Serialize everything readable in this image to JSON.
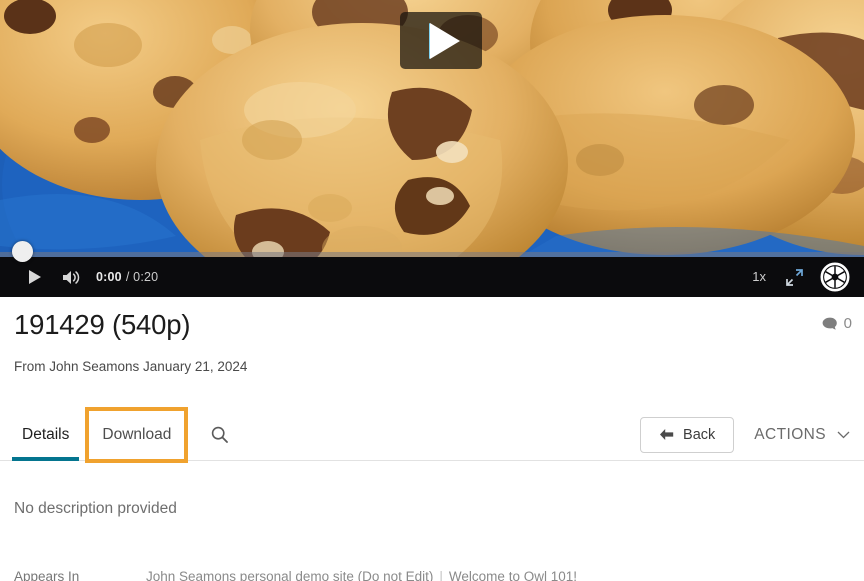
{
  "player": {
    "poster_alt": "chocolate-chip-cookies-on-blue-plate",
    "play_overlay_label": "Play",
    "controls": {
      "play_label": "Play",
      "volume_label": "Mute",
      "current_time": "0:00",
      "duration": "/ 0:20",
      "speed": "1x",
      "fullscreen_label": "Fullscreen",
      "settings_label": "Settings"
    }
  },
  "header": {
    "title": "191429 (540p)",
    "byline": "From John Seamons January 21, 2024",
    "comment_count": "0"
  },
  "tabs": [
    {
      "label": "Details",
      "active": true
    },
    {
      "label": "Download",
      "active": false,
      "highlighted": true
    }
  ],
  "toolbar": {
    "search_label": "Search",
    "back_label": "Back",
    "actions_label": "ACTIONS"
  },
  "body": {
    "description": "No description provided",
    "appears_in_label": "Appears In",
    "appears_in_links": [
      "John Seamons personal demo site (Do not Edit)",
      "Welcome to Owl 101!"
    ],
    "link_separator": "|"
  },
  "colors": {
    "tab_active_underline": "#04758f",
    "highlight_box": "#f0a22e",
    "control_bar_bg": "#0b0b0d",
    "plate_blue": "#1d57ad",
    "cookie": "#e2ac5d"
  }
}
